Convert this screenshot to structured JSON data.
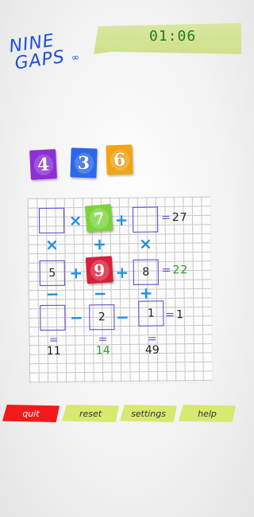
{
  "logo": {
    "line1": "NINE",
    "line2": "GAPS",
    "suffix": "∞"
  },
  "timer": "01:06",
  "tiles": [
    {
      "digit": "4",
      "color": "#8e2fd6"
    },
    {
      "digit": "3",
      "color": "#2e68e8"
    },
    {
      "digit": "6",
      "color": "#f2a514"
    }
  ],
  "board": {
    "row1": {
      "c1": "",
      "op1": "×",
      "c2": "7",
      "op2": "+",
      "c3": "",
      "result": "27"
    },
    "row2": {
      "c1": "5",
      "op1": "+",
      "c2": "9",
      "op2": "+",
      "c3": "8",
      "result": "22"
    },
    "row3": {
      "c1": "",
      "op1": "−",
      "c2": "2",
      "op2": "−",
      "c3": "1",
      "result": "1"
    },
    "col_ops_12": [
      "×",
      "+",
      "×"
    ],
    "col_ops_23": [
      "−",
      "−",
      "+"
    ],
    "col_results": [
      "11",
      "14",
      "49"
    ],
    "eq": "=",
    "fixed_colors": {
      "seven": "#7bd43a",
      "nine": "#d81f3a"
    }
  },
  "menu": {
    "quit": "quit",
    "reset": "reset",
    "settings": "settings",
    "help": "help",
    "quit_color": "#f01a1a",
    "other_color": "#d9e870"
  }
}
